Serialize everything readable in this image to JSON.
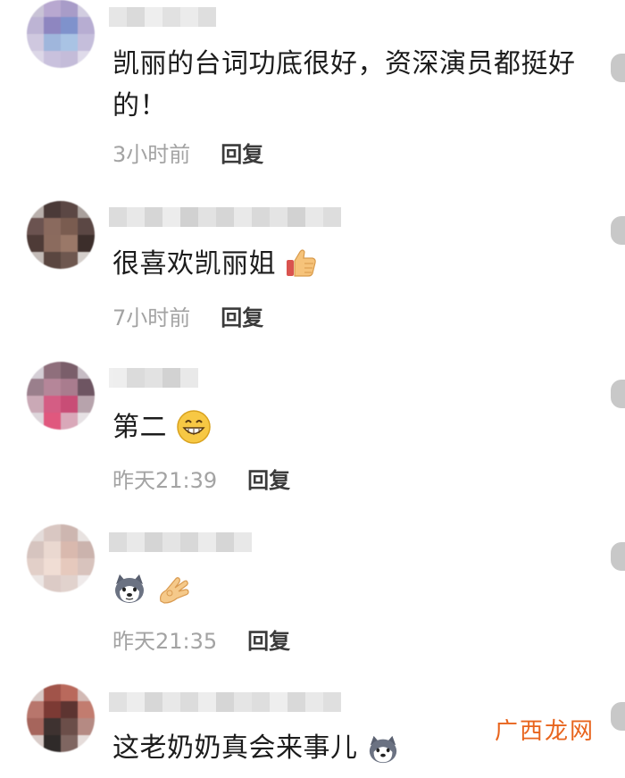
{
  "comments": [
    {
      "text": "凯丽的台词功底很好，资深演员都挺好的！",
      "time": "3小时前",
      "reply": "回复"
    },
    {
      "text": "很喜欢凯丽姐",
      "time": "7小时前",
      "reply": "回复",
      "emoji": "thumbs-up-icon"
    },
    {
      "text": "第二",
      "time": "昨天21:39",
      "reply": "回复",
      "emoji": "grin-icon"
    },
    {
      "text": "",
      "time": "昨天21:35",
      "reply": "回复",
      "emoji": "husky-dog-icon, ok-hand-icon"
    },
    {
      "text": "这老奶奶真会来事儿",
      "emoji": "husky-dog-icon"
    }
  ],
  "watermark": "广西龙网",
  "colors": {
    "text": "#1c1c1c",
    "meta": "#a3a3a3",
    "reply": "#3b3b3b",
    "watermark": "#e8641d"
  }
}
